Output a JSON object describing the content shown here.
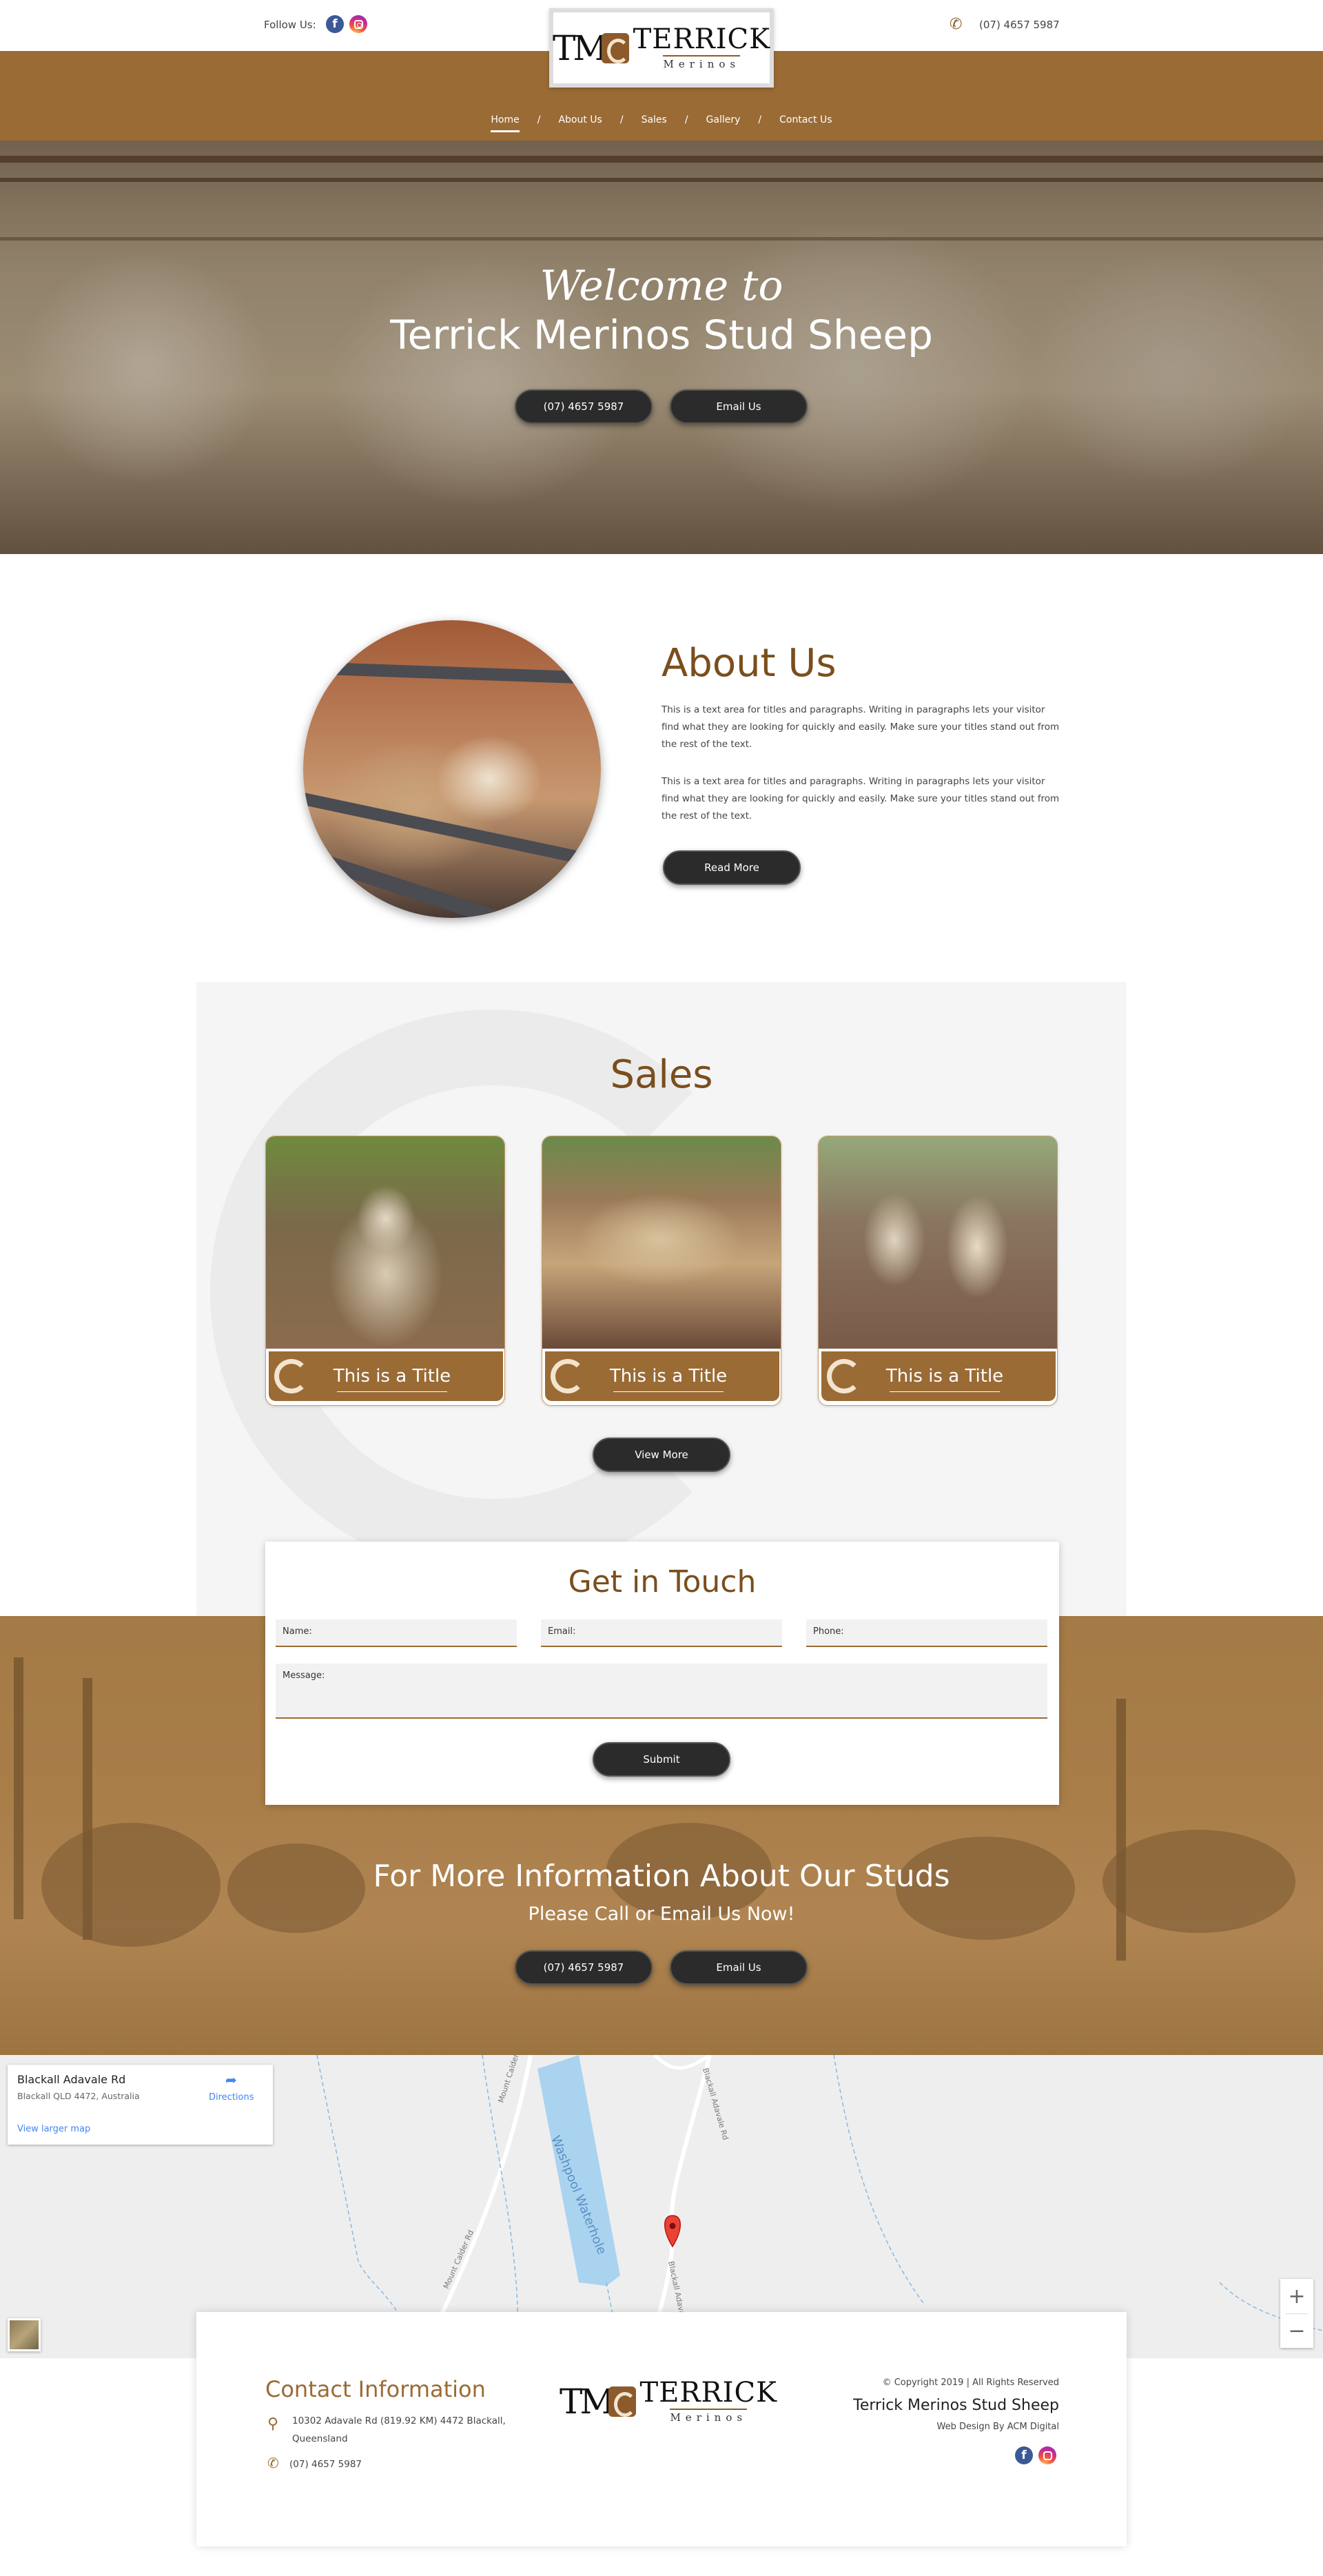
{
  "header": {
    "follow_label": "Follow Us:",
    "phone": "(07) 4657 5987",
    "logo": {
      "initials": "TM",
      "name": "TERRICK",
      "sub": "Merinos"
    },
    "nav": [
      "Home",
      "About Us",
      "Sales",
      "Gallery",
      "Contact Us"
    ],
    "nav_active": "Home"
  },
  "hero": {
    "script": "Welcome to",
    "title": "Terrick Merinos Stud Sheep",
    "phone_button": "(07) 4657 5987",
    "email_button": "Email Us"
  },
  "about": {
    "title": "About Us",
    "p1": "This is a text area for titles and paragraphs. Writing in paragraphs lets your visitor find what they are looking for quickly and easily. Make sure your titles stand out from the rest of the text.",
    "p2": "This is a text area for titles and paragraphs. Writing in paragraphs lets your visitor find what they are looking for quickly and easily. Make sure your titles stand out from the rest of the text.",
    "button": "Read More"
  },
  "sales": {
    "title": "Sales",
    "cards": [
      {
        "title": "This is a Title"
      },
      {
        "title": "This is a Title"
      },
      {
        "title": "This is a Title"
      }
    ],
    "button": "View More"
  },
  "contact_form": {
    "title": "Get in Touch",
    "name_label": "Name:",
    "email_label": "Email:",
    "phone_label": "Phone:",
    "message_label": "Message:",
    "submit": "Submit"
  },
  "cta": {
    "title": "For More Information About Our Studs",
    "subtitle": "Please Call or Email Us Now!",
    "phone_button": "(07) 4657 5987",
    "email_button": "Email Us"
  },
  "map": {
    "place": "Blackall Adavale Rd",
    "address": "Blackall QLD 4472, Australia",
    "directions": "Directions",
    "larger": "View larger map",
    "water_label": "Washpool Waterhole",
    "road1": "Mount Calder Rd",
    "road2": "Blackall Adavale Rd",
    "road3": "Mount Calder",
    "road4": "Blackall Adavale Rd",
    "zoom_in": "+",
    "zoom_out": "−"
  },
  "footer": {
    "contact_title": "Contact Information",
    "address_line1": "10302 Adavale Rd (819.92 KM) 4472 Blackall,",
    "address_line2": "Queensland",
    "phone": "(07) 4657 5987",
    "copyright": "© Copyright 2019 | All Rights Reserved",
    "site_name": "Terrick Merinos Stud Sheep",
    "credit": "Web Design By ACM Digital"
  },
  "colors": {
    "brand_brown": "#9a6b35",
    "title_brown": "#7a4e1d",
    "button_dark": "#2b2b2b"
  }
}
